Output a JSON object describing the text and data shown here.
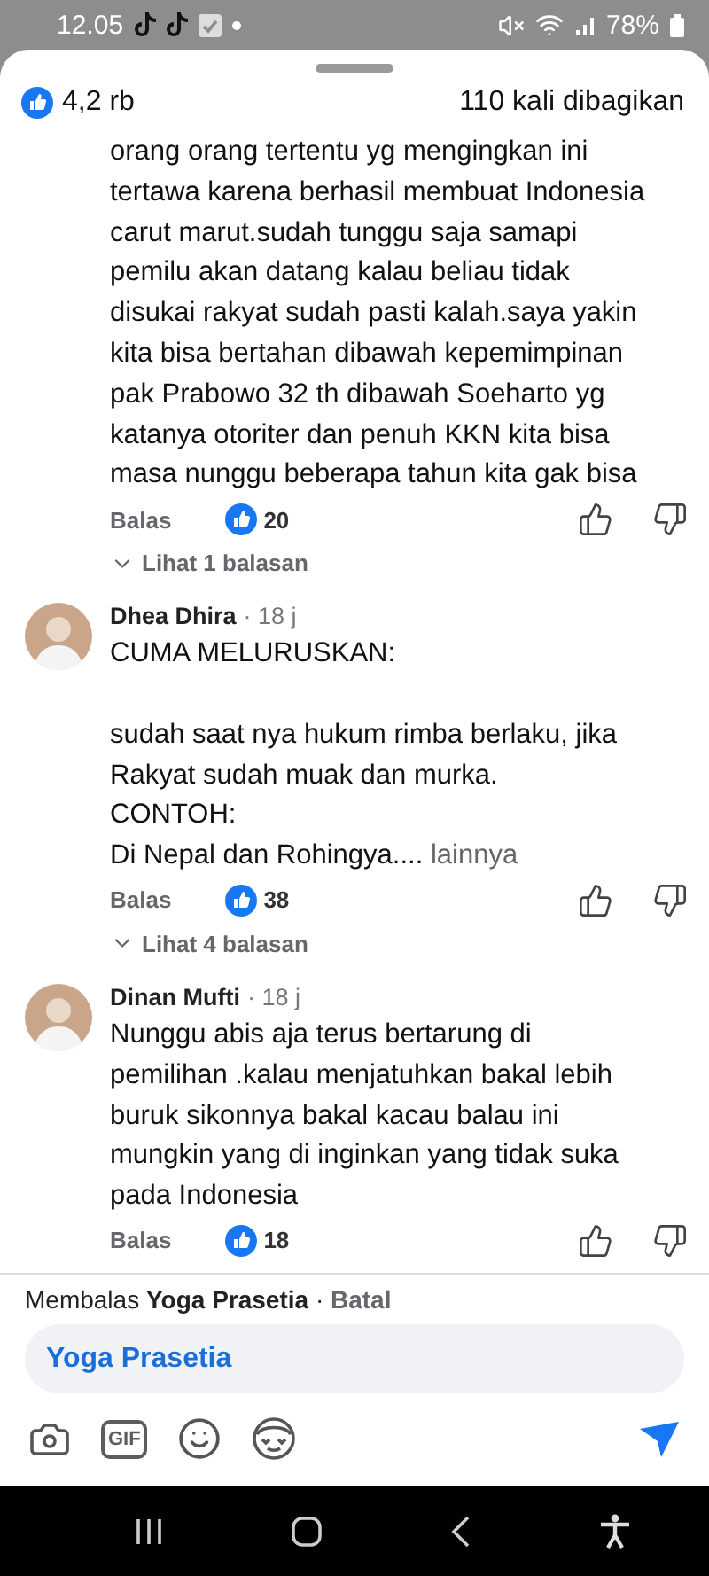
{
  "status_bar": {
    "time": "12.05",
    "battery": "78%"
  },
  "header": {
    "reactions": "4,2 rb",
    "shares": "110 kali dibagikan"
  },
  "comments": [
    {
      "text": "orang orang tertentu yg mengingkan ini\ntertawa karena berhasil membuat Indonesia\ncarut marut.sudah tunggu saja samapi\npemilu akan datang kalau beliau tidak\ndisukai rakyat sudah pasti kalah.saya yakin\nkita bisa bertahan dibawah kepemimpinan\npak Prabowo 32 th dibawah Soeharto yg\nkatanya otoriter dan penuh KKN kita bisa\nmasa nunggu beberapa tahun kita gak bisa",
      "reply": "Balas",
      "likes": "20",
      "replies": "Lihat 1 balasan"
    },
    {
      "author": "Dhea Dhira",
      "time": "· 18 j",
      "text": "CUMA MELURUSKAN:\n\nsudah saat nya hukum rimba berlaku, jika\nRakyat sudah muak dan murka.\nCONTOH:\nDi Nepal dan Rohingya....",
      "more": "lainnya",
      "reply": "Balas",
      "likes": "38",
      "replies": "Lihat 4 balasan"
    },
    {
      "author": "Dinan Mufti",
      "time": "· 18 j",
      "text": "Nunggu abis aja terus bertarung di\npemilihan .kalau menjatuhkan bakal lebih\nburuk sikonnya bakal kacau balau ini\nmungkin yang di inginkan yang tidak suka\npada Indonesia",
      "reply": "Balas",
      "likes": "18"
    }
  ],
  "composer": {
    "replying_prefix": "Membalas",
    "replying_to": "Yoga Prasetia",
    "separator": "·",
    "cancel": "Batal",
    "value": "Yoga Prasetia",
    "gif": "GIF"
  }
}
